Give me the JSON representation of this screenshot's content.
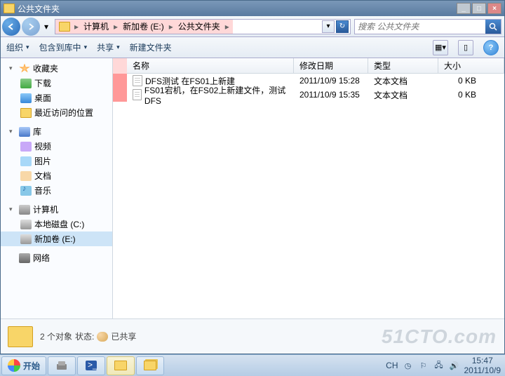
{
  "window": {
    "title": "公共文件夹",
    "min": "_",
    "max": "□",
    "close": "×"
  },
  "nav": {
    "back": "◄",
    "forward": "►",
    "dropdown": "▾",
    "refresh": "↻",
    "history": "▾"
  },
  "breadcrumb": {
    "items": [
      "计算机",
      "新加卷 (E:)",
      "公共文件夹"
    ],
    "sep": "▸"
  },
  "search": {
    "placeholder": "搜索 公共文件夹",
    "icon": "🔍"
  },
  "toolbar": {
    "organize": "组织",
    "include": "包含到库中",
    "share": "共享",
    "newfolder": "新建文件夹",
    "help": "?"
  },
  "sidebar": {
    "favorites": {
      "label": "收藏夹"
    },
    "downloads": {
      "label": "下载"
    },
    "desktop": {
      "label": "桌面"
    },
    "recent": {
      "label": "最近访问的位置"
    },
    "libraries": {
      "label": "库"
    },
    "videos": {
      "label": "视频"
    },
    "pictures": {
      "label": "图片"
    },
    "documents": {
      "label": "文档"
    },
    "music": {
      "label": "音乐"
    },
    "computer": {
      "label": "计算机"
    },
    "localdisk": {
      "label": "本地磁盘 (C:)"
    },
    "newvol": {
      "label": "新加卷 (E:)"
    },
    "network": {
      "label": "网络"
    }
  },
  "columns": {
    "name": "名称",
    "date": "修改日期",
    "type": "类型",
    "size": "大小"
  },
  "files": [
    {
      "name": "DFS测试 在FS01上新建",
      "date": "2011/10/9 15:28",
      "type": "文本文档",
      "size": "0 KB"
    },
    {
      "name": "FS01宕机，在FS02上新建文件，测试DFS",
      "date": "2011/10/9 15:35",
      "type": "文本文档",
      "size": "0 KB"
    }
  ],
  "status": {
    "count": "2 个对象",
    "state_label": "状态:",
    "shared": "已共享"
  },
  "watermark": "51CTO.com",
  "taskbar": {
    "start": "开始",
    "lang": "CH",
    "time": "15:47",
    "date": "2011/10/9"
  }
}
